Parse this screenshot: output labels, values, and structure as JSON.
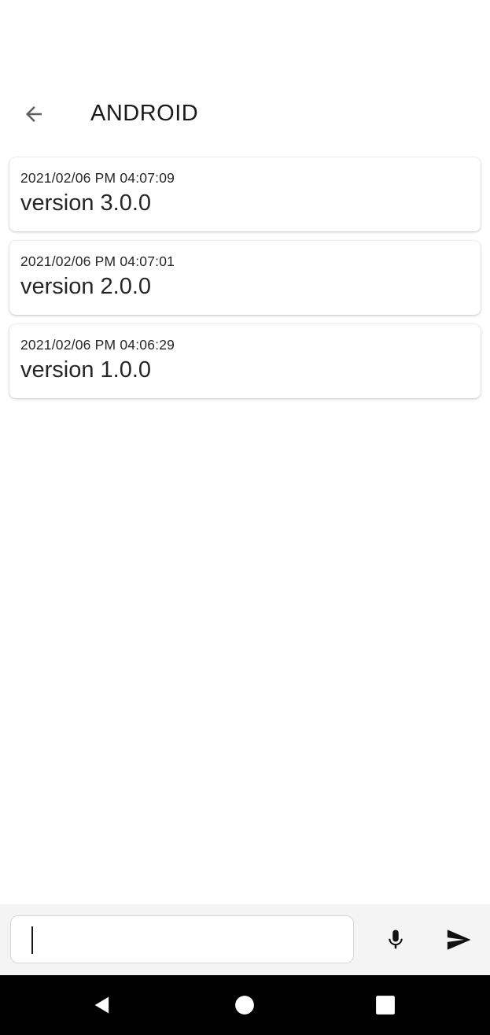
{
  "header": {
    "title": "ANDROID",
    "back_icon": "arrow-back-icon"
  },
  "versions": [
    {
      "timestamp": "2021/02/06 PM 04:07:09",
      "title": "version 3.0.0"
    },
    {
      "timestamp": "2021/02/06 PM 04:07:01",
      "title": "version 2.0.0"
    },
    {
      "timestamp": "2021/02/06 PM 04:06:29",
      "title": "version 1.0.0"
    }
  ],
  "composer": {
    "input_value": "",
    "mic_icon": "microphone-icon",
    "send_icon": "send-icon"
  },
  "system_nav": {
    "back_icon": "nav-back-triangle-icon",
    "home_icon": "nav-home-circle-icon",
    "recents_icon": "nav-recents-square-icon"
  },
  "colors": {
    "background": "#ffffff",
    "text": "#262626",
    "input_bar": "#f4f4f4",
    "nav_bar": "#000000"
  }
}
